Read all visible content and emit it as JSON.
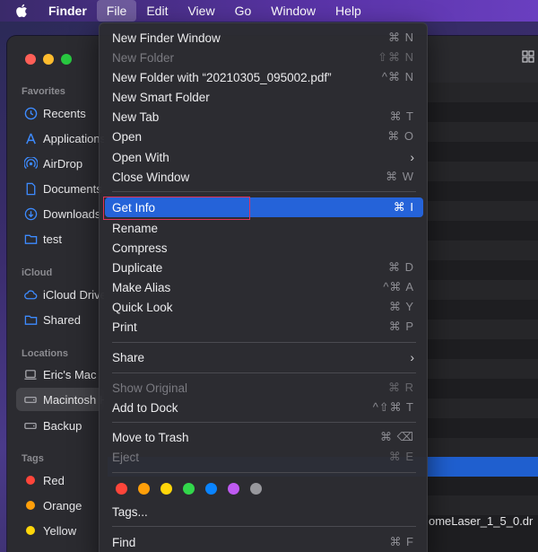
{
  "menubar": {
    "app": "Finder",
    "items": [
      "File",
      "Edit",
      "View",
      "Go",
      "Window",
      "Help"
    ]
  },
  "sidebar": {
    "favorites_header": "Favorites",
    "favorites": [
      "Recents",
      "Applications",
      "AirDrop",
      "Documents",
      "Downloads",
      "test"
    ],
    "icloud_header": "iCloud",
    "icloud": [
      "iCloud Drive",
      "Shared"
    ],
    "locations_header": "Locations",
    "locations": [
      "Eric's Mac",
      "Macintosh HD",
      "Backup"
    ],
    "tags_header": "Tags",
    "tags": [
      {
        "label": "Red",
        "color": "#ff453a"
      },
      {
        "label": "Orange",
        "color": "#ff9f0a"
      },
      {
        "label": "Yellow",
        "color": "#ffd60a"
      }
    ]
  },
  "content": {
    "visible_filename": "omeLaser_1_5_0.dr"
  },
  "file_menu": {
    "new_finder_window": {
      "label": "New Finder Window",
      "shortcut": "⌘ N"
    },
    "new_folder": {
      "label": "New Folder",
      "shortcut": "⇧⌘ N"
    },
    "new_folder_with": {
      "label": "New Folder with “20210305_095002.pdf”",
      "shortcut": "^⌘ N"
    },
    "new_smart_folder": {
      "label": "New Smart Folder",
      "shortcut": ""
    },
    "new_tab": {
      "label": "New Tab",
      "shortcut": "⌘ T"
    },
    "open": {
      "label": "Open",
      "shortcut": "⌘ O"
    },
    "open_with": {
      "label": "Open With",
      "shortcut": "›"
    },
    "close_window": {
      "label": "Close Window",
      "shortcut": "⌘ W"
    },
    "get_info": {
      "label": "Get Info",
      "shortcut": "⌘  I"
    },
    "rename": {
      "label": "Rename",
      "shortcut": ""
    },
    "compress": {
      "label": "Compress",
      "shortcut": ""
    },
    "duplicate": {
      "label": "Duplicate",
      "shortcut": "⌘ D"
    },
    "make_alias": {
      "label": "Make Alias",
      "shortcut": "^⌘ A"
    },
    "quick_look": {
      "label": "Quick Look",
      "shortcut": "⌘ Y"
    },
    "print": {
      "label": "Print",
      "shortcut": "⌘ P"
    },
    "share": {
      "label": "Share",
      "shortcut": "›"
    },
    "show_original": {
      "label": "Show Original",
      "shortcut": "⌘ R"
    },
    "add_to_dock": {
      "label": "Add to Dock",
      "shortcut": "^⇧⌘ T"
    },
    "move_to_trash": {
      "label": "Move to Trash",
      "shortcut": "⌘ ⌫"
    },
    "eject": {
      "label": "Eject",
      "shortcut": "⌘ E"
    },
    "tag_colors": [
      "#ff453a",
      "#ff9f0a",
      "#ffd60a",
      "#32d74b",
      "#0a84ff",
      "#bf5af2",
      "#98989d"
    ],
    "tags": {
      "label": "Tags...",
      "shortcut": ""
    },
    "find": {
      "label": "Find",
      "shortcut": "⌘ F"
    }
  }
}
